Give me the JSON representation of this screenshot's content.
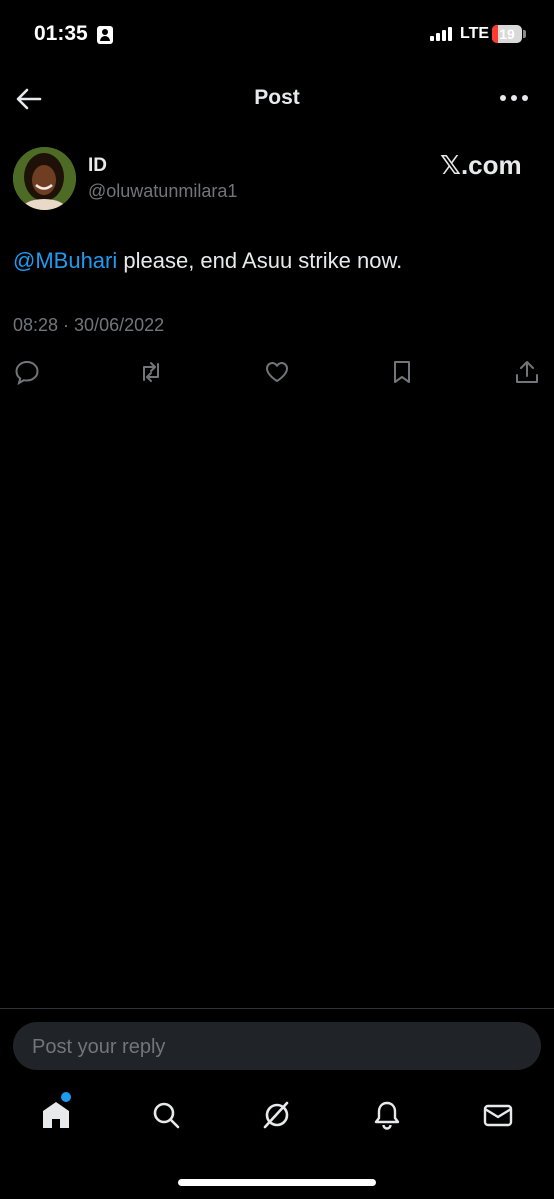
{
  "status_bar": {
    "time": "01:35",
    "network": "LTE",
    "battery": "19",
    "battery_level": 0.19
  },
  "header": {
    "title": "Post",
    "back_icon": "arrow-left-icon",
    "more_icon": "more-dots-icon"
  },
  "author": {
    "name": "ID",
    "handle": "@oluwatunmilara1",
    "watermark": "𝕏.com"
  },
  "post": {
    "mention": "@MBuhari",
    "text": " please, end Asuu strike now.",
    "timestamp": "08:28 · 30/06/2022"
  },
  "actions": [
    "reply-icon",
    "repost-icon",
    "like-icon",
    "bookmark-icon",
    "share-icon"
  ],
  "reply_box": {
    "placeholder": "Post your reply"
  },
  "tab_bar": [
    "home-icon",
    "search-icon",
    "grok-icon",
    "notifications-icon",
    "messages-icon"
  ],
  "colors": {
    "background": "#000000",
    "accent": "#1d9bf0",
    "muted": "#71767b",
    "text": "#e7e9ea"
  }
}
